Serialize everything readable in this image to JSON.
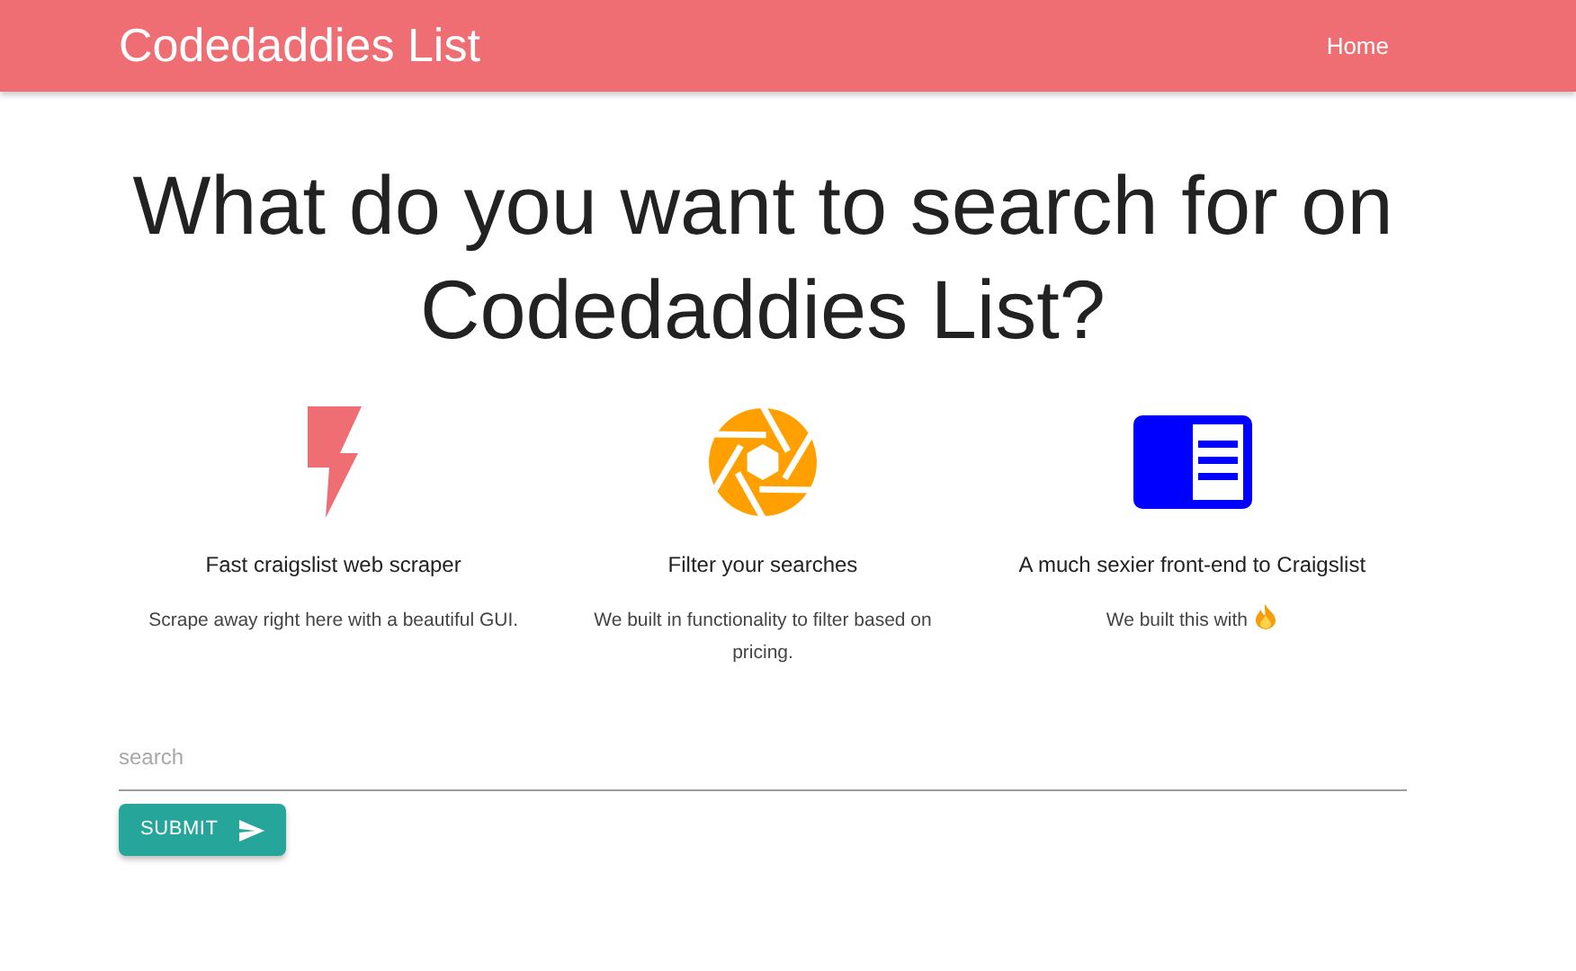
{
  "navbar": {
    "brand": "Codedaddies List",
    "links": [
      "Home"
    ]
  },
  "heading": "What do you want to search for on Codedaddies List?",
  "features": [
    {
      "kind": "bolt",
      "title": "Fast craigslist web scraper",
      "text": "Scrape away right here with a beautiful GUI."
    },
    {
      "kind": "aperture",
      "title": "Filter your searches",
      "text": "We built in functionality to filter based on pricing."
    },
    {
      "kind": "panel",
      "title": "A much sexier front-end to Craigslist",
      "text": "We built this with"
    }
  ],
  "search": {
    "placeholder": "search"
  },
  "submit_button": "SUBMIT"
}
